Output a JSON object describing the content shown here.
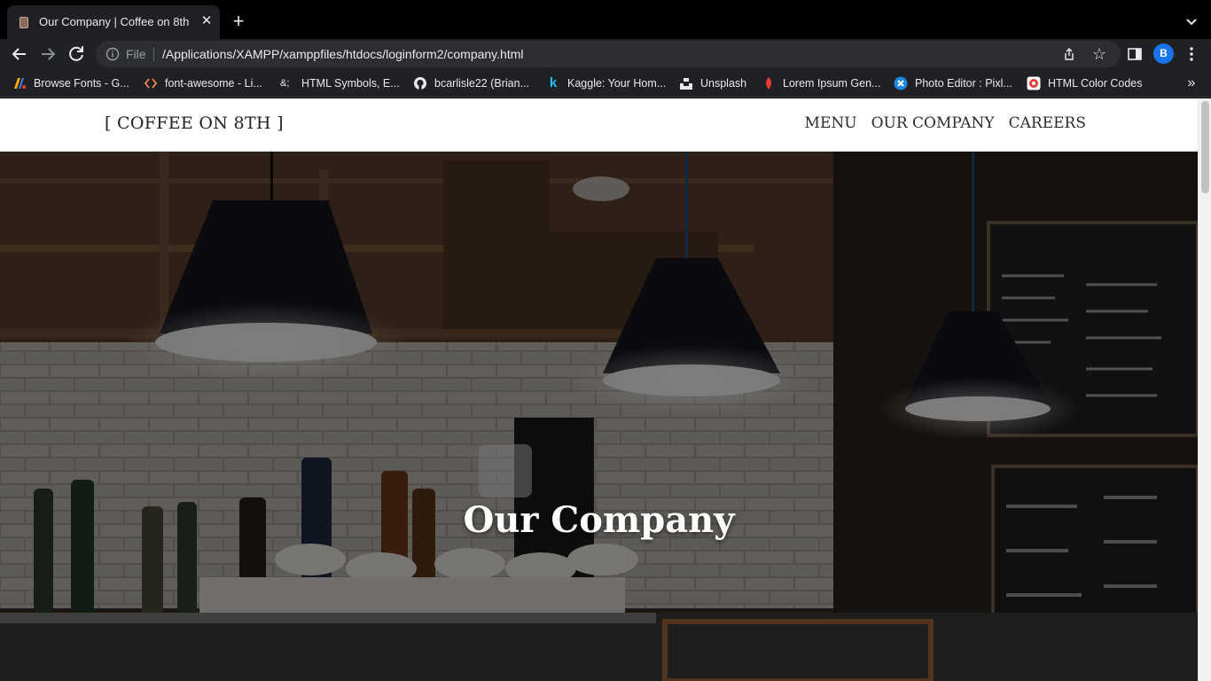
{
  "browser": {
    "tab_title": "Our Company | Coffee on 8th",
    "new_tab_symbol": "+",
    "close_symbol": "✕",
    "file_label": "File",
    "url": "/Applications/XAMPP/xamppfiles/htdocs/loginform2/company.html",
    "profile_initial": "B",
    "bookmarks_overflow": "»",
    "bookmarks": [
      {
        "label": "Browse Fonts - G...",
        "icon": "google-fonts-icon"
      },
      {
        "label": "font-awesome - Li...",
        "icon": "code-brackets-icon"
      },
      {
        "label": "HTML Symbols, E...",
        "icon": "ampersand-icon"
      },
      {
        "label": "bcarlisle22 (Brian...",
        "icon": "github-icon"
      },
      {
        "label": "Kaggle: Your Hom...",
        "icon": "kaggle-icon"
      },
      {
        "label": "Unsplash",
        "icon": "unsplash-icon"
      },
      {
        "label": "Lorem Ipsum Gen...",
        "icon": "lorem-ipsum-icon"
      },
      {
        "label": "Photo Editor : Pixl...",
        "icon": "pixlr-icon"
      },
      {
        "label": "HTML Color Codes",
        "icon": "color-codes-icon"
      }
    ],
    "bookmark_glyphs": {
      "ampersand": "&;",
      "kaggle": "k"
    }
  },
  "site": {
    "brand": "[ COFFEE ON 8TH ]",
    "nav": [
      {
        "label": "MENU"
      },
      {
        "label": "OUR COMPANY"
      },
      {
        "label": "CAREERS"
      }
    ],
    "hero_title": "Our Company"
  },
  "colors": {
    "chrome_bg": "#202124",
    "page_header_bg": "#ffffff",
    "hero_overlay": "#000000",
    "accent_profile": "#1a73e8"
  }
}
